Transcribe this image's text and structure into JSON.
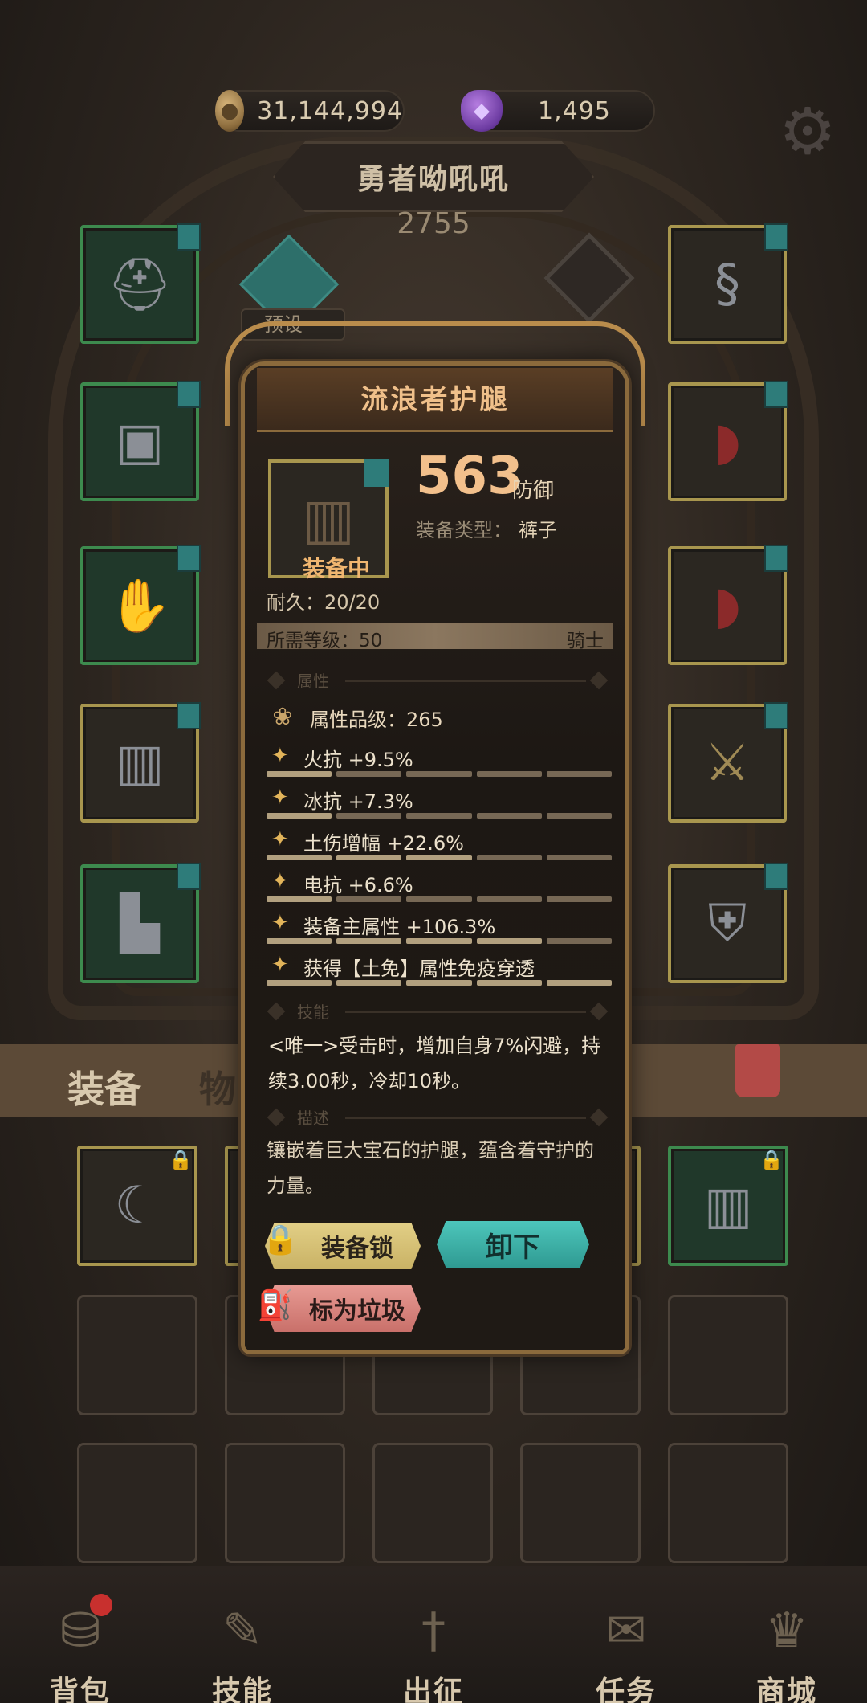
{
  "currency": {
    "coins": "31,144,994",
    "gems": "1,495",
    "coin_icon": "coin-icon",
    "gem_icon": "gem-icon"
  },
  "hero": {
    "name": "勇者呦吼吼",
    "power": "2755",
    "preset_label": "预设一"
  },
  "tabs": {
    "equipment": "装备",
    "items": "物"
  },
  "modal": {
    "title": "流浪者护腿",
    "equipped_label": "装备中",
    "stat_value": "563",
    "stat_unit": "防御",
    "type_label": "装备类型：",
    "type_value": "裤子",
    "durability": "耐久：20/20",
    "required_level": "所需等级：50",
    "class": "骑士",
    "sections": {
      "attributes": "属性",
      "skills": "技能",
      "description": "描述"
    },
    "attr_grade": "属性品级：265",
    "attributes": [
      {
        "text": "火抗 +9.5%",
        "fill": 0.2
      },
      {
        "text": "冰抗 +7.3%",
        "fill": 0.15
      },
      {
        "text": "土伤增幅 +22.6%",
        "fill": 0.55
      },
      {
        "text": "电抗 +6.6%",
        "fill": 0.13
      },
      {
        "text": "装备主属性 +106.3%",
        "fill": 0.85
      },
      {
        "text": "获得【土免】属性免疫穿透",
        "fill": 1.0
      }
    ],
    "skill_text": "<唯一>受击时，增加自身7%闪避，持续3.00秒，冷却10秒。",
    "description": "镶嵌着巨大宝石的护腿，蕴含着守护的力量。",
    "buttons": {
      "lock": "装备锁",
      "unequip": "卸下",
      "trash": "标为垃圾"
    }
  },
  "nav": {
    "bag": "背包",
    "skills": "技能",
    "expedition": "出征",
    "tasks": "任务",
    "shop": "商城"
  },
  "colors": {
    "accent_gold": "#f2c08c",
    "teal": "#2e9a92",
    "trash_red": "#c9706a"
  }
}
